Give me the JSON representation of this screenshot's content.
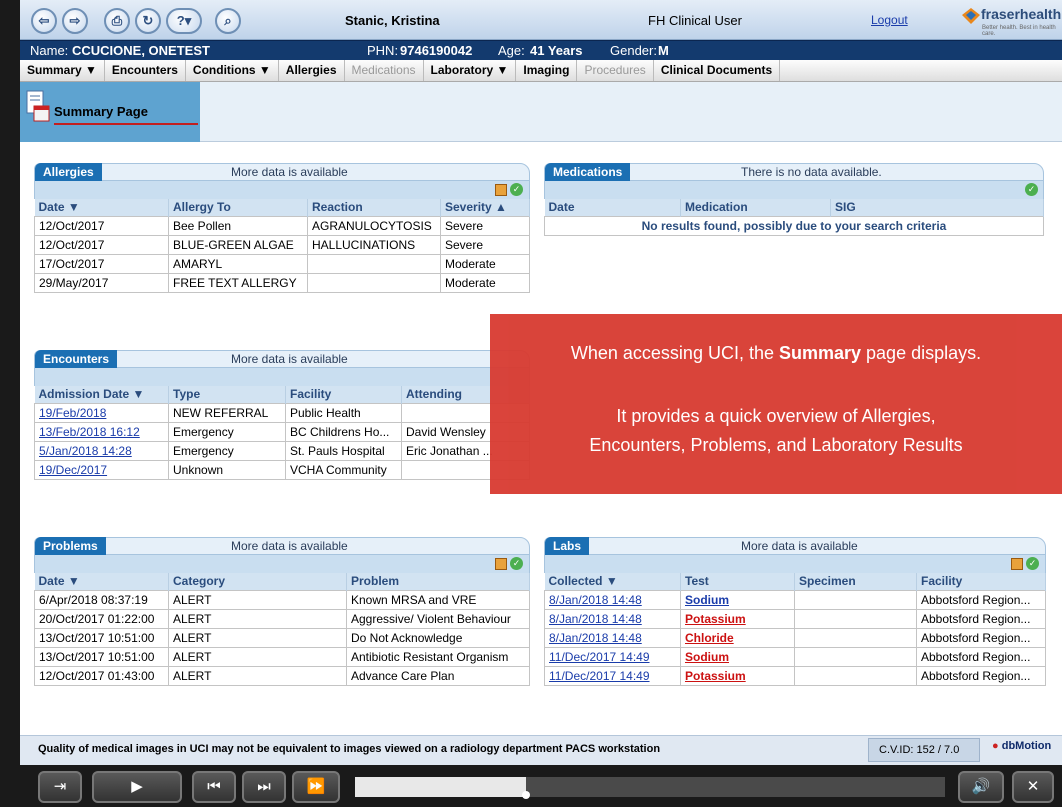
{
  "topbar": {
    "user": "Stanic, Kristina",
    "role": "FH Clinical User",
    "logout": "Logout",
    "logo_text": "fraserhealth",
    "logo_sub": "Better health. Best in health care."
  },
  "patient": {
    "name_label": "Name:",
    "name": "CCUCIONE, ONETEST",
    "phn_label": "PHN:",
    "phn": "9746190042",
    "age_label": "Age:",
    "age": "41 Years",
    "gender_label": "Gender:",
    "gender": "M"
  },
  "nav": [
    {
      "label": "Summary ▼",
      "enabled": true
    },
    {
      "label": "Encounters",
      "enabled": true
    },
    {
      "label": "Conditions ▼",
      "enabled": true
    },
    {
      "label": "Allergies",
      "enabled": true
    },
    {
      "label": "Medications",
      "enabled": false
    },
    {
      "label": "Laboratory ▼",
      "enabled": true
    },
    {
      "label": "Imaging",
      "enabled": true
    },
    {
      "label": "Procedures",
      "enabled": false
    },
    {
      "label": "Clinical Documents",
      "enabled": true
    }
  ],
  "summary_title": "Summary Page",
  "allergies": {
    "title": "Allergies",
    "more": "More data is available",
    "headers": [
      "Date ▼",
      "Allergy To",
      "Reaction",
      "Severity ▲"
    ],
    "rows": [
      [
        "12/Oct/2017",
        "Bee Pollen",
        "AGRANULOCYTOSIS",
        "Severe"
      ],
      [
        "12/Oct/2017",
        "BLUE-GREEN ALGAE",
        "HALLUCINATIONS",
        "Severe"
      ],
      [
        "17/Oct/2017",
        "AMARYL",
        "",
        "Moderate"
      ],
      [
        "29/May/2017",
        "FREE TEXT ALLERGY",
        "",
        "Moderate"
      ]
    ]
  },
  "medications": {
    "title": "Medications",
    "more": "There is no data available.",
    "headers": [
      "Date",
      "Medication",
      "SIG"
    ],
    "empty": "No results found, possibly due to your search criteria"
  },
  "encounters": {
    "title": "Encounters",
    "more": "More data is available",
    "headers": [
      "Admission Date ▼",
      "Type",
      "Facility",
      "Attending"
    ],
    "rows": [
      [
        "19/Feb/2018",
        "NEW REFERRAL",
        "Public Health",
        ""
      ],
      [
        "13/Feb/2018 16:12",
        "Emergency",
        "BC Childrens Ho...",
        "David Wensley"
      ],
      [
        "5/Jan/2018 14:28",
        "Emergency",
        "St. Pauls Hospital",
        "Eric Jonathan ..."
      ],
      [
        "19/Dec/2017",
        "Unknown",
        "VCHA Community",
        ""
      ]
    ]
  },
  "problems": {
    "title": "Problems",
    "more": "More data is available",
    "headers": [
      "Date ▼",
      "Category",
      "Problem"
    ],
    "rows": [
      [
        "6/Apr/2018 08:37:19",
        "ALERT",
        "Known MRSA and VRE"
      ],
      [
        "20/Oct/2017 01:22:00",
        "ALERT",
        "Aggressive/ Violent Behaviour"
      ],
      [
        "13/Oct/2017 10:51:00",
        "ALERT",
        "Do Not Acknowledge"
      ],
      [
        "13/Oct/2017 10:51:00",
        "ALERT",
        "Antibiotic Resistant Organism"
      ],
      [
        "12/Oct/2017 01:43:00",
        "ALERT",
        "Advance Care Plan"
      ]
    ]
  },
  "labs": {
    "title": "Labs",
    "more": "More data is available",
    "headers": [
      "Collected ▼",
      "Test",
      "Specimen",
      "Facility"
    ],
    "rows": [
      {
        "collected": "8/Jan/2018 14:48",
        "test": "Sodium",
        "abnormal": false,
        "specimen": "",
        "facility": "Abbotsford Region..."
      },
      {
        "collected": "8/Jan/2018 14:48",
        "test": "Potassium",
        "abnormal": true,
        "specimen": "",
        "facility": "Abbotsford Region..."
      },
      {
        "collected": "8/Jan/2018 14:48",
        "test": "Chloride",
        "abnormal": true,
        "specimen": "",
        "facility": "Abbotsford Region..."
      },
      {
        "collected": "11/Dec/2017 14:49",
        "test": "Sodium",
        "abnormal": true,
        "specimen": "",
        "facility": "Abbotsford Region..."
      },
      {
        "collected": "11/Dec/2017 14:49",
        "test": "Potassium",
        "abnormal": true,
        "specimen": "",
        "facility": "Abbotsford Region..."
      }
    ]
  },
  "overlay": {
    "line1_pre": "When accessing UCI, the ",
    "line1_bold": "Summary",
    "line1_post": " page displays.",
    "line2": "It provides a quick overview of Allergies,",
    "line3": "Encounters, Problems, and Laboratory Results"
  },
  "status": {
    "message": "Quality of medical images in UCI may not be equivalent to images viewed on a radiology department PACS workstation",
    "cvid": "C.V.ID: 152 / 7.0",
    "brand": "dbMotion"
  },
  "player": {
    "progress": 0.29
  },
  "colors": {
    "panel_header": "#1b6fb3",
    "patient_bar": "#133a6e",
    "overlay": "#d83a30",
    "abnormal_lab": "#cc1111"
  }
}
